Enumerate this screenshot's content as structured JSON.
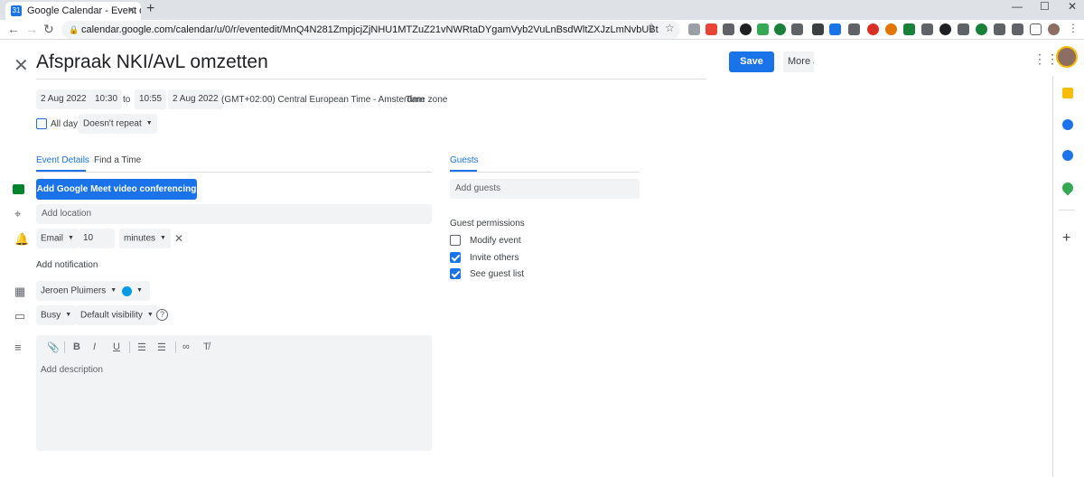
{
  "browser": {
    "tab_title": "Google Calendar - Event details",
    "tab_close": "✕",
    "new_tab": "+",
    "url": "calendar.google.com/calendar/u/0/r/eventedit/MnQ4N281ZmpjcjZjNHU1MTZuZ21vNWRtaDYgamVyb2VuLnBsdWltZXJzLmNvbUBt"
  },
  "header": {
    "title": "Afspraak NKI/AvL omzetten",
    "save_label": "Save",
    "more_label": "More actions"
  },
  "datetime": {
    "start_date": "2 Aug 2022",
    "start_time": "10:30",
    "to": "to",
    "end_time": "10:55",
    "end_date": "2 Aug 2022",
    "timezone_text": "(GMT+02:00) Central European Time - Amsterdam",
    "timezone_button": "Time zone",
    "all_day_label": "All day",
    "repeat": "Doesn't repeat"
  },
  "tabs": {
    "event_details": "Event Details",
    "find_time": "Find a Time",
    "guests": "Guests"
  },
  "details": {
    "meet_button": "Add Google Meet video conferencing",
    "location_placeholder": "Add location",
    "notification_type": "Email",
    "notification_value": "10",
    "notification_unit": "minutes",
    "add_notification": "Add notification",
    "calendar_owner": "Jeroen Pluimers",
    "calendar_color": "#039be5",
    "busy": "Busy",
    "visibility": "Default visibility",
    "description_placeholder": "Add description"
  },
  "guests": {
    "add_placeholder": "Add guests",
    "permissions_title": "Guest permissions",
    "permissions": [
      {
        "label": "Modify event",
        "checked": false
      },
      {
        "label": "Invite others",
        "checked": true
      },
      {
        "label": "See guest list",
        "checked": true
      }
    ]
  },
  "colors": {
    "accent": "#1a73e8",
    "field_bg": "#f1f3f4"
  }
}
